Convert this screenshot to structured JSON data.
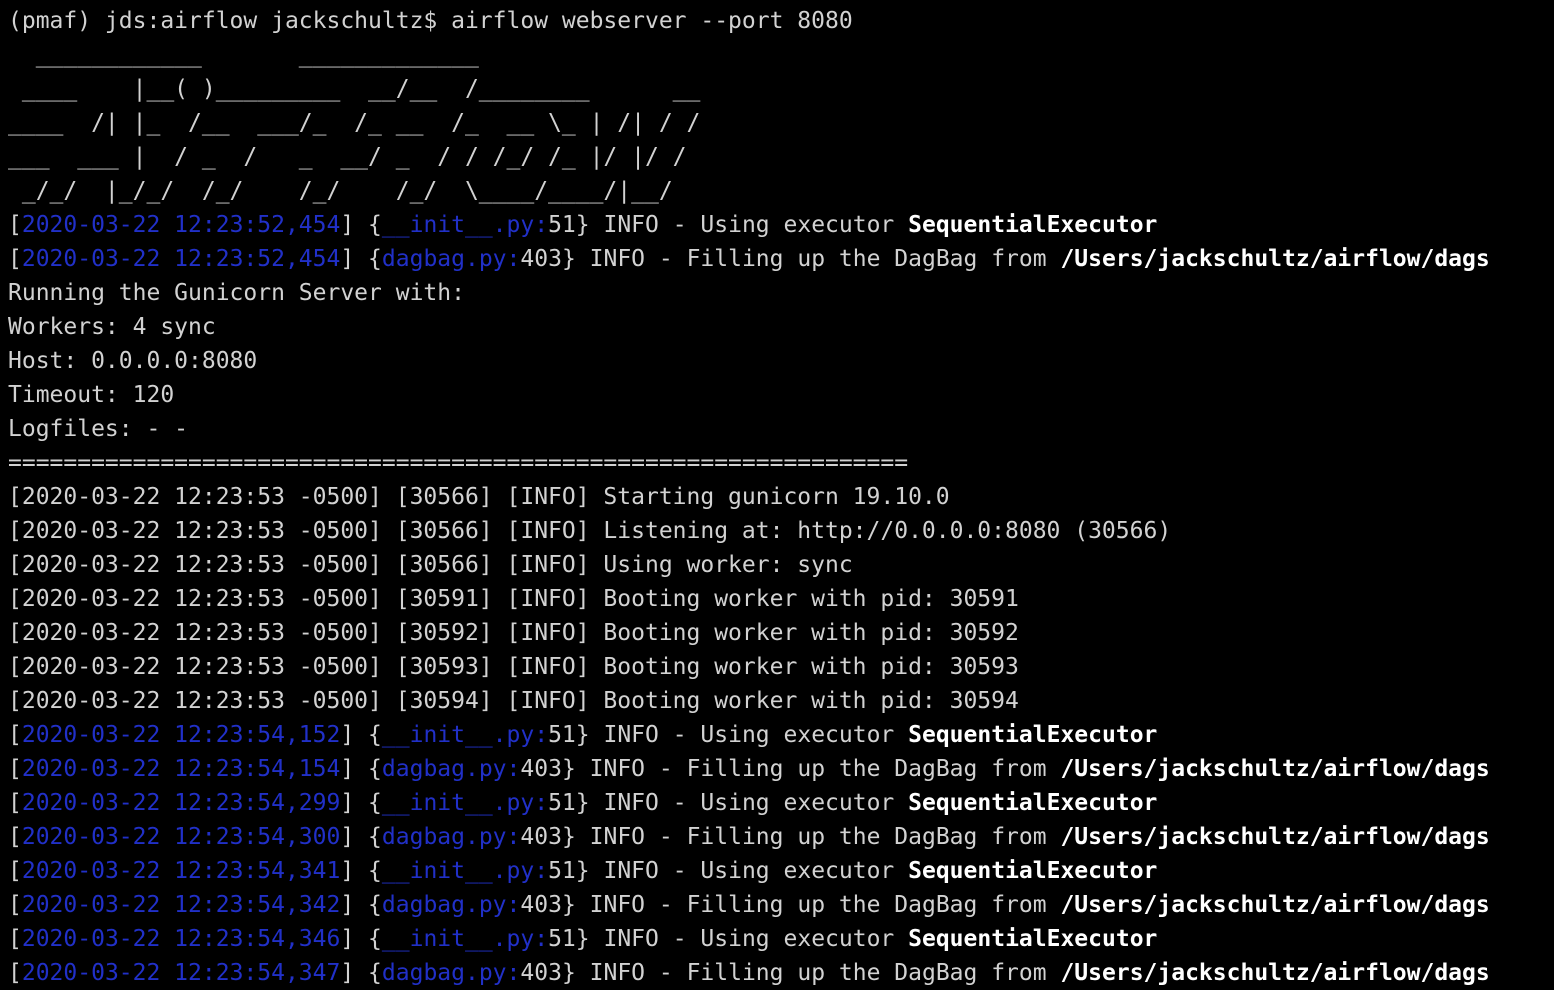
{
  "colors": {
    "background": "#000000",
    "text": "#d2d2d2",
    "link_blue": "#2130c8",
    "bright": "#ffffff"
  },
  "prompt": "(pmaf) jds:airflow jackschultz$ airflow webserver --port 8080",
  "banner": [
    "  ____________       _____________",
    " ____    |__( )_________  __/__  /________      __",
    "____  /| |_  /__  ___/_  /_ __  /_  __ \\_ | /| / /",
    "___  ___ |  / _  /   _  __/ _  / / /_/ /_ |/ |/ /",
    " _/_/  |_/_/  /_/    /_/    /_/  \\____/____/|__/"
  ],
  "log_top": [
    {
      "ts": "2020-03-22 12:23:52,454",
      "file": "__init__.py:",
      "lineno": "51",
      "msg": " INFO - Using executor ",
      "target": "SequentialExecutor"
    },
    {
      "ts": "2020-03-22 12:23:52,454",
      "file": "dagbag.py:",
      "lineno": "403",
      "msg": " INFO - Filling up the DagBag from ",
      "target": "/Users/jackschultz/airflow/dags"
    }
  ],
  "gunicorn_info": [
    "Running the Gunicorn Server with:",
    "Workers: 4 sync",
    "Host: 0.0.0.0:8080",
    "Timeout: 120",
    "Logfiles: - -"
  ],
  "separator": "=================================================================",
  "gunicorn_log": [
    "[2020-03-22 12:23:53 -0500] [30566] [INFO] Starting gunicorn 19.10.0",
    "[2020-03-22 12:23:53 -0500] [30566] [INFO] Listening at: http://0.0.0.0:8080 (30566)",
    "[2020-03-22 12:23:53 -0500] [30566] [INFO] Using worker: sync",
    "[2020-03-22 12:23:53 -0500] [30591] [INFO] Booting worker with pid: 30591",
    "[2020-03-22 12:23:53 -0500] [30592] [INFO] Booting worker with pid: 30592",
    "[2020-03-22 12:23:53 -0500] [30593] [INFO] Booting worker with pid: 30593",
    "[2020-03-22 12:23:53 -0500] [30594] [INFO] Booting worker with pid: 30594"
  ],
  "log_bottom": [
    {
      "ts": "2020-03-22 12:23:54,152",
      "file": "__init__.py:",
      "lineno": "51",
      "msg": " INFO - Using executor ",
      "target": "SequentialExecutor"
    },
    {
      "ts": "2020-03-22 12:23:54,154",
      "file": "dagbag.py:",
      "lineno": "403",
      "msg": " INFO - Filling up the DagBag from ",
      "target": "/Users/jackschultz/airflow/dags"
    },
    {
      "ts": "2020-03-22 12:23:54,299",
      "file": "__init__.py:",
      "lineno": "51",
      "msg": " INFO - Using executor ",
      "target": "SequentialExecutor"
    },
    {
      "ts": "2020-03-22 12:23:54,300",
      "file": "dagbag.py:",
      "lineno": "403",
      "msg": " INFO - Filling up the DagBag from ",
      "target": "/Users/jackschultz/airflow/dags"
    },
    {
      "ts": "2020-03-22 12:23:54,341",
      "file": "__init__.py:",
      "lineno": "51",
      "msg": " INFO - Using executor ",
      "target": "SequentialExecutor"
    },
    {
      "ts": "2020-03-22 12:23:54,342",
      "file": "dagbag.py:",
      "lineno": "403",
      "msg": " INFO - Filling up the DagBag from ",
      "target": "/Users/jackschultz/airflow/dags"
    },
    {
      "ts": "2020-03-22 12:23:54,346",
      "file": "__init__.py:",
      "lineno": "51",
      "msg": " INFO - Using executor ",
      "target": "SequentialExecutor"
    },
    {
      "ts": "2020-03-22 12:23:54,347",
      "file": "dagbag.py:",
      "lineno": "403",
      "msg": " INFO - Filling up the DagBag from ",
      "target": "/Users/jackschultz/airflow/dags"
    }
  ]
}
